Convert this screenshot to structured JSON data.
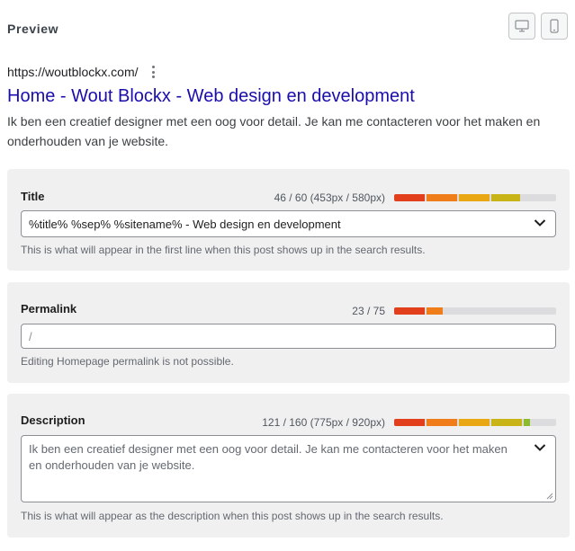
{
  "preview": {
    "heading": "Preview",
    "devices": [
      {
        "name": "desktop-icon",
        "active": false
      },
      {
        "name": "mobile-icon",
        "active": false
      }
    ]
  },
  "serp": {
    "url": "https://woutblockx.com/",
    "title": "Home - Wout Blockx - Web design en development",
    "description": "Ik ben een creatief designer met een oog voor detail. Je kan me contacteren voor het maken en onderhouden van je website."
  },
  "fields": {
    "title": {
      "label": "Title",
      "counter": "46 / 60 (453px / 580px)",
      "value": "%title% %sep% %sitename% - Web design en development",
      "help": "This is what will appear in the first line when this post shows up in the search results.",
      "progress": 0.78
    },
    "permalink": {
      "label": "Permalink",
      "counter": "23 / 75",
      "value": "/",
      "help": "Editing Homepage permalink is not possible.",
      "progress": 0.3
    },
    "description": {
      "label": "Description",
      "counter": "121 / 160 (775px / 920px)",
      "value": "Ik ben een creatief designer met een oog voor detail. Je kan me contacteren voor het maken en onderhouden van je website.",
      "help": "This is what will appear as the description when this post shows up in the search results.",
      "progress": 0.84
    }
  },
  "colors": {
    "serp_title": "#1a0dab",
    "bar_colors": [
      "#e2401c",
      "#ef7d1a",
      "#e9a714",
      "#c8b417",
      "#8cbc2b",
      "#5aa72a"
    ]
  }
}
